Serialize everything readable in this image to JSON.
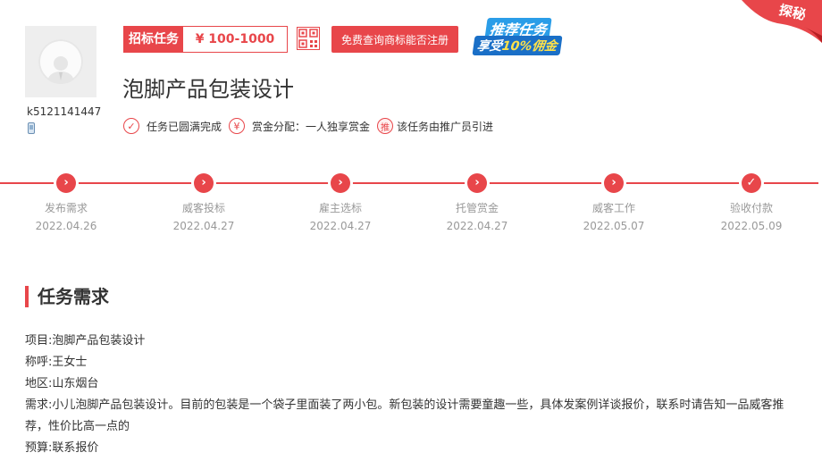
{
  "user": {
    "name": "k5121141447"
  },
  "task": {
    "type_label": "招标任务",
    "price": "¥ 100-1000",
    "check_button": "免费查询商标能否注册",
    "title": "泡脚产品包装设计",
    "promo_line1": "推荐任务",
    "promo_line2_prefix": "享受",
    "promo_line2_highlight": "10%佣金",
    "corner": "探秘"
  },
  "tags": [
    {
      "icon": "check-icon",
      "label": "任务已圆满完成"
    },
    {
      "icon": "yen-icon",
      "label": "赏金分配：一人独享赏金"
    },
    {
      "icon": "recommend-icon",
      "icon_text": "推",
      "label": "该任务由推广员引进"
    }
  ],
  "steps": [
    {
      "name": "发布需求",
      "date": "2022.04.26"
    },
    {
      "name": "威客投标",
      "date": "2022.04.27"
    },
    {
      "name": "雇主选标",
      "date": "2022.04.27"
    },
    {
      "name": "托管赏金",
      "date": "2022.04.27"
    },
    {
      "name": "威客工作",
      "date": "2022.05.07"
    },
    {
      "name": "验收付款",
      "date": "2022.05.09"
    }
  ],
  "requirements": {
    "title": "任务需求",
    "lines": [
      "项目:泡脚产品包装设计",
      "称呼:王女士",
      "地区:山东烟台",
      "需求:小儿泡脚产品包装设计。目前的包装是一个袋子里面装了两小包。新包装的设计需要童趣一些，具体发案例详谈报价，联系时请告知一品威客推荐，性价比高一点的",
      "预算:联系报价"
    ]
  },
  "colors": {
    "accent": "#e8464a",
    "muted": "#999999"
  }
}
